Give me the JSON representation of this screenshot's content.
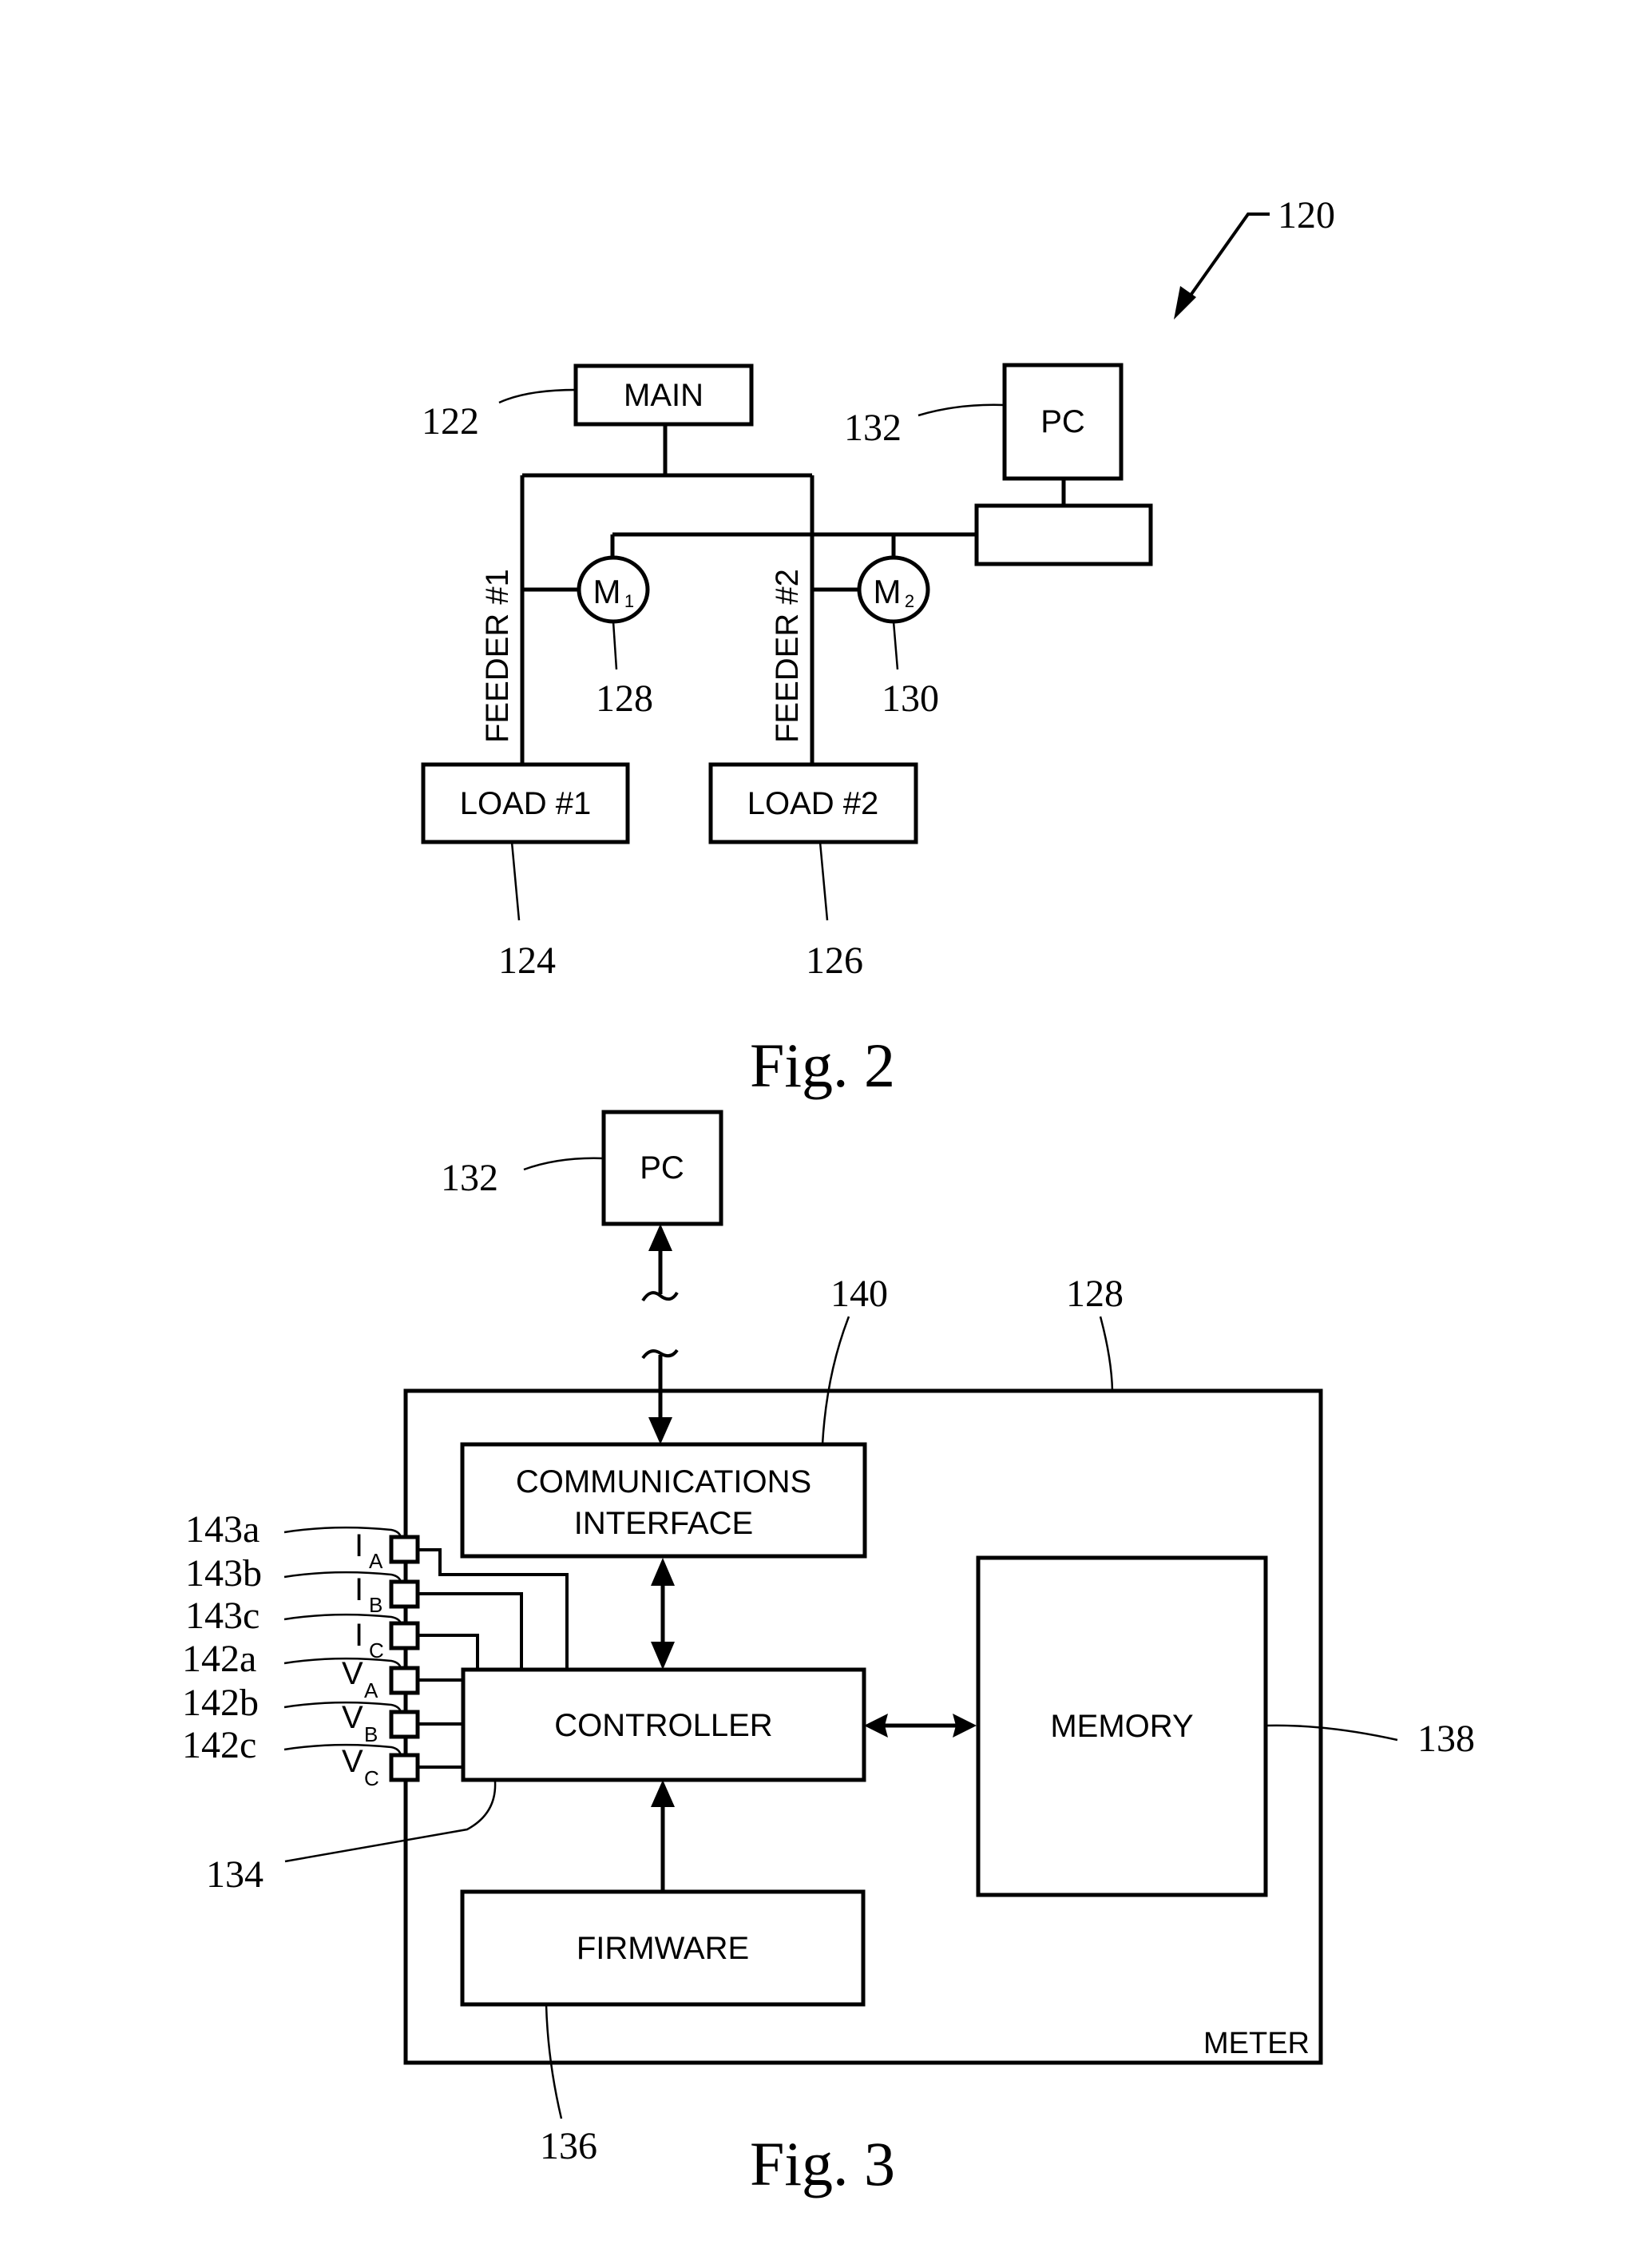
{
  "page": {
    "background": "#ffffff",
    "ink": "#000000"
  },
  "fig2": {
    "caption": "Fig. 2",
    "system_ref": "120",
    "main": {
      "label": "MAIN",
      "ref": "122"
    },
    "pc": {
      "label": "PC",
      "ref": "132"
    },
    "feeders": [
      {
        "label": "FEEDER #1"
      },
      {
        "label": "FEEDER #2"
      }
    ],
    "meters": [
      {
        "symbol": "M",
        "subscript": "1",
        "ref": "128"
      },
      {
        "symbol": "M",
        "subscript": "2",
        "ref": "130"
      }
    ],
    "loads": [
      {
        "label": "LOAD #1",
        "ref": "124"
      },
      {
        "label": "LOAD #2",
        "ref": "126"
      }
    ]
  },
  "fig3": {
    "caption": "Fig. 3",
    "pc": {
      "label": "PC",
      "ref": "132"
    },
    "meter": {
      "label": "METER",
      "ref": "128"
    },
    "communications_interface": {
      "line1": "COMMUNICATIONS",
      "line2": "INTERFACE",
      "ref": "140"
    },
    "controller": {
      "label": "CONTROLLER",
      "ref": "134"
    },
    "memory": {
      "label": "MEMORY",
      "ref": "138"
    },
    "firmware": {
      "label": "FIRMWARE",
      "ref": "136"
    },
    "inputs": [
      {
        "letter": "I",
        "sub": "A",
        "ref": "143a"
      },
      {
        "letter": "I",
        "sub": "B",
        "ref": "143b"
      },
      {
        "letter": "I",
        "sub": "C",
        "ref": "143c"
      },
      {
        "letter": "V",
        "sub": "A",
        "ref": "142a"
      },
      {
        "letter": "V",
        "sub": "B",
        "ref": "142b"
      },
      {
        "letter": "V",
        "sub": "C",
        "ref": "142c"
      }
    ]
  }
}
